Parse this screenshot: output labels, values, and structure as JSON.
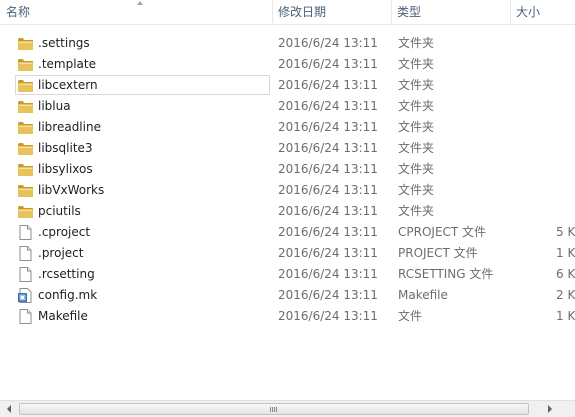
{
  "columns": {
    "name": "名称",
    "date": "修改日期",
    "type": "类型",
    "size": "大小"
  },
  "files": [
    {
      "name": ".settings",
      "date": "2016/6/24 13:11",
      "type": "文件夹",
      "size": "",
      "icon": "folder-icon"
    },
    {
      "name": ".template",
      "date": "2016/6/24 13:11",
      "type": "文件夹",
      "size": "",
      "icon": "folder-icon"
    },
    {
      "name": "libcextern",
      "date": "2016/6/24 13:11",
      "type": "文件夹",
      "size": "",
      "icon": "folder-icon",
      "selected": true
    },
    {
      "name": "liblua",
      "date": "2016/6/24 13:11",
      "type": "文件夹",
      "size": "",
      "icon": "folder-icon"
    },
    {
      "name": "libreadline",
      "date": "2016/6/24 13:11",
      "type": "文件夹",
      "size": "",
      "icon": "folder-icon"
    },
    {
      "name": "libsqlite3",
      "date": "2016/6/24 13:11",
      "type": "文件夹",
      "size": "",
      "icon": "folder-icon"
    },
    {
      "name": "libsylixos",
      "date": "2016/6/24 13:11",
      "type": "文件夹",
      "size": "",
      "icon": "folder-icon"
    },
    {
      "name": "libVxWorks",
      "date": "2016/6/24 13:11",
      "type": "文件夹",
      "size": "",
      "icon": "folder-icon"
    },
    {
      "name": "pciutils",
      "date": "2016/6/24 13:11",
      "type": "文件夹",
      "size": "",
      "icon": "folder-icon"
    },
    {
      "name": ".cproject",
      "date": "2016/6/24 13:11",
      "type": "CPROJECT 文件",
      "size": "5 K",
      "icon": "file-icon"
    },
    {
      "name": ".project",
      "date": "2016/6/24 13:11",
      "type": "PROJECT 文件",
      "size": "1 K",
      "icon": "file-icon"
    },
    {
      "name": ".rcsetting",
      "date": "2016/6/24 13:11",
      "type": "RCSETTING 文件",
      "size": "6 K",
      "icon": "file-icon"
    },
    {
      "name": "config.mk",
      "date": "2016/6/24 13:11",
      "type": "Makefile",
      "size": "2 K",
      "icon": "makefile-icon"
    },
    {
      "name": "Makefile",
      "date": "2016/6/24 13:11",
      "type": "文件",
      "size": "1 K",
      "icon": "file-icon"
    }
  ],
  "colors": {
    "folder": "#e8c25a",
    "folder_dark": "#c99a2e",
    "header_text": "#4c607a",
    "meta_text": "#6d6d6d"
  }
}
